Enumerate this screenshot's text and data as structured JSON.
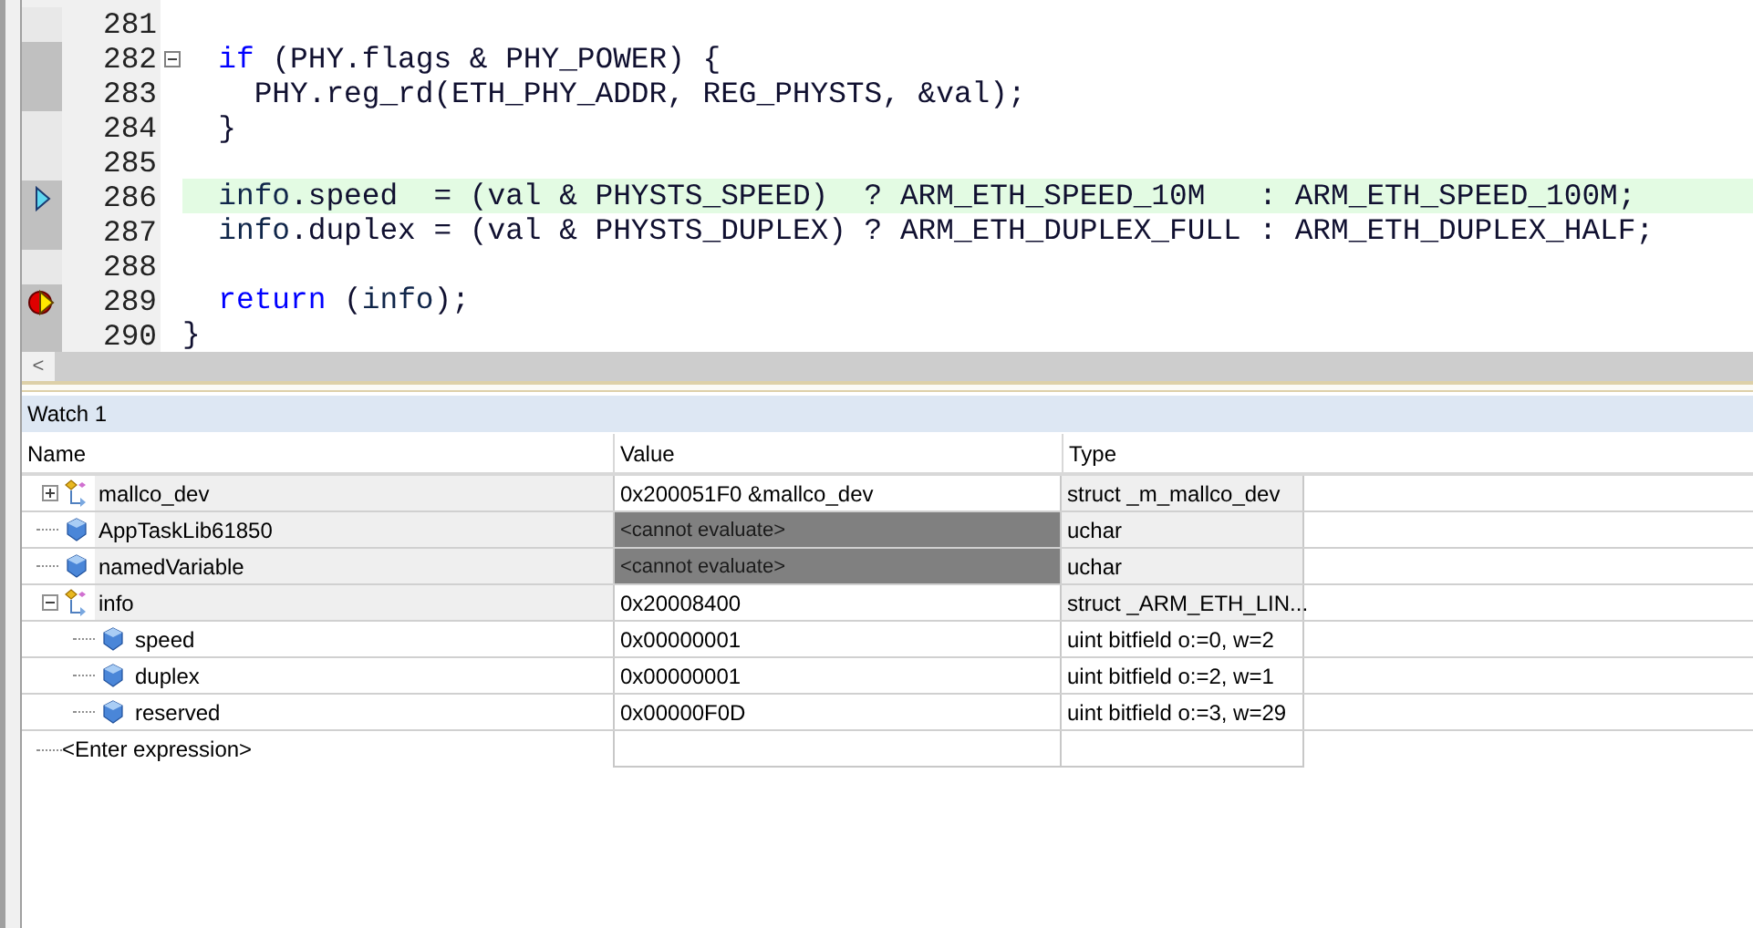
{
  "editor": {
    "lines": [
      {
        "number": "281",
        "executable": false,
        "current": false,
        "breakpoint": false
      },
      {
        "number": "282",
        "executable": true,
        "current": false,
        "breakpoint": false,
        "expanded": true,
        "tokens": [
          {
            "kind": "keyword",
            "text": "  if"
          },
          {
            "kind": "plain",
            "text": " (PHY.flags & PHY_POWER) {"
          }
        ]
      },
      {
        "number": "283",
        "executable": true,
        "current": false,
        "breakpoint": false,
        "tokens": [
          {
            "kind": "plain",
            "text": "    PHY.reg_rd(ETH_PHY_ADDR, REG_PHYSTS, &val);"
          }
        ]
      },
      {
        "number": "284",
        "executable": false,
        "current": false,
        "breakpoint": false,
        "tokens": [
          {
            "kind": "plain",
            "text": "  }"
          }
        ]
      },
      {
        "number": "285",
        "executable": false,
        "current": false,
        "breakpoint": false
      },
      {
        "number": "286",
        "executable": true,
        "current": true,
        "breakpoint": false,
        "tokens": [
          {
            "kind": "symbol",
            "text": "  info"
          },
          {
            "kind": "plain",
            "text": ".speed  = (val & PHYSTS_SPEED)  ? ARM_ETH_SPEED_10M   : ARM_ETH_SPEED_100M;"
          }
        ]
      },
      {
        "number": "287",
        "executable": true,
        "current": false,
        "breakpoint": false,
        "tokens": [
          {
            "kind": "symbol",
            "text": "  info"
          },
          {
            "kind": "plain",
            "text": ".duplex = (val & PHYSTS_DUPLEX) ? ARM_ETH_DUPLEX_FULL : ARM_ETH_DUPLEX_HALF;"
          }
        ]
      },
      {
        "number": "288",
        "executable": false,
        "current": false,
        "breakpoint": false
      },
      {
        "number": "289",
        "executable": true,
        "current": true,
        "breakpoint": true,
        "tokens": [
          {
            "kind": "keyword",
            "text": "  return"
          },
          {
            "kind": "plain",
            "text": " ("
          },
          {
            "kind": "symbol",
            "text": "info"
          },
          {
            "kind": "plain",
            "text": ");"
          }
        ]
      },
      {
        "number": "290",
        "executable": true,
        "current": false,
        "breakpoint": false,
        "tokens": [
          {
            "kind": "plain",
            "text": "}"
          }
        ]
      }
    ],
    "scroll_left": "<"
  },
  "watch": {
    "title": "Watch 1",
    "columns": [
      "Name",
      "Value",
      "Type"
    ],
    "rows": [
      {
        "name": "mallco_dev",
        "value": "0x200051F0 &mallco_dev",
        "type": "struct _m_mallco_dev",
        "kind": "struct",
        "expanded": false,
        "error": false
      },
      {
        "name": "AppTaskLib61850",
        "value": "<cannot evaluate>",
        "type": "uchar",
        "kind": "variable",
        "error": true
      },
      {
        "name": "namedVariable",
        "value": "<cannot evaluate>",
        "type": "uchar",
        "kind": "variable",
        "error": true
      },
      {
        "name": "info",
        "value": "0x20008400",
        "type": "struct _ARM_ETH_LIN...",
        "kind": "struct",
        "expanded": true,
        "error": false,
        "children": [
          {
            "name": "speed",
            "value": "0x00000001",
            "type": "uint bitfield o:=0, w=2",
            "kind": "variable",
            "error": false
          },
          {
            "name": "duplex",
            "value": "0x00000001",
            "type": "uint bitfield o:=2, w=1",
            "kind": "variable",
            "error": false
          },
          {
            "name": "reserved",
            "value": "0x00000F0D",
            "type": "uint bitfield o:=3, w=29",
            "kind": "variable",
            "error": false
          }
        ]
      }
    ],
    "enter_expression": "<Enter expression>"
  }
}
